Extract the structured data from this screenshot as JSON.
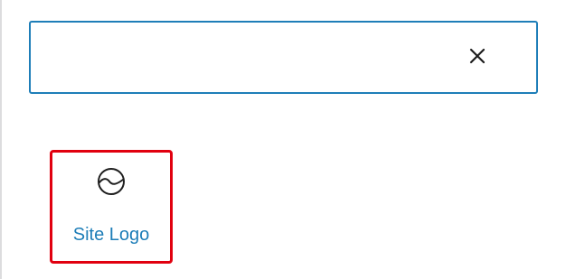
{
  "search": {
    "value": "",
    "placeholder": "",
    "clear_icon": "close-icon"
  },
  "blocks": [
    {
      "label": "Site Logo",
      "icon": "site-logo-icon"
    }
  ],
  "colors": {
    "accent": "#1e7eb8",
    "highlight": "#e1000f",
    "icon": "#1e1e1e",
    "divider": "#dcdcde"
  }
}
